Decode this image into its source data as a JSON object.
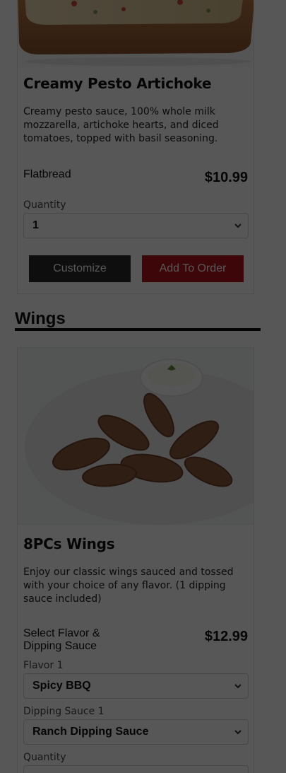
{
  "pesto_card": {
    "title": "Creamy Pesto Artichoke",
    "description": "Creamy pesto sauce, 100% whole milk mozzarella, artichoke hearts, and diced tomatoes, topped with basil seasoning.",
    "size_label": "Flatbread",
    "price": "$10.99",
    "quantity_label": "Quantity",
    "quantity_value": "1",
    "customize_label": "Customize",
    "add_label": "Add To Order"
  },
  "wings_section": {
    "title": "Wings"
  },
  "wings_card": {
    "title": "8PCs Wings",
    "description": "Enjoy our classic wings sauced and tossed with your choice of any flavor. (1 dipping sauce included)",
    "option_label": "Select Flavor & Dipping Sauce",
    "price": "$12.99",
    "flavor_label": "Flavor 1",
    "flavor_value": "Spicy BBQ",
    "dipping_label": "Dipping Sauce 1",
    "dipping_value": "Ranch Dipping Sauce",
    "quantity_label": "Quantity"
  },
  "colors": {
    "overlay": "#000000",
    "add_button": "#b3141b",
    "customize_button": "#2a2a2a"
  }
}
